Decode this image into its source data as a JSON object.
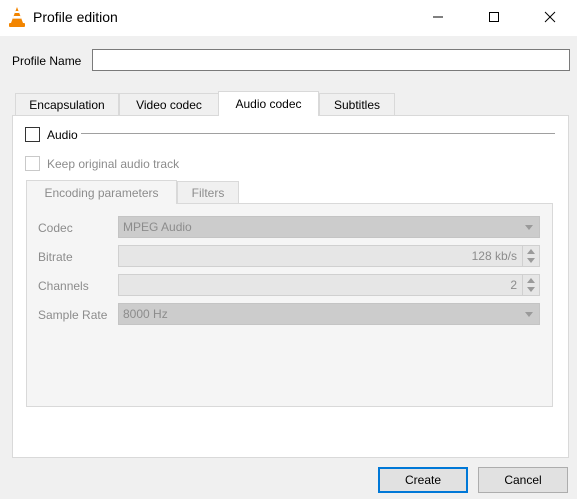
{
  "window": {
    "title": "Profile edition",
    "icon": "vlc-cone-icon",
    "controls": [
      "minimize-icon",
      "maximize-icon",
      "close-icon"
    ]
  },
  "profile": {
    "label": "Profile Name",
    "value": "",
    "placeholder": ""
  },
  "tabs": [
    {
      "label": "Encapsulation",
      "active": false
    },
    {
      "label": "Video codec",
      "active": false
    },
    {
      "label": "Audio codec",
      "active": true
    },
    {
      "label": "Subtitles",
      "active": false
    }
  ],
  "audio": {
    "enable_label": "Audio",
    "enable_checked": false,
    "keep_original_label": "Keep original audio track",
    "keep_original_checked": false,
    "subtabs": [
      {
        "label": "Encoding parameters",
        "active": true
      },
      {
        "label": "Filters",
        "active": false
      }
    ],
    "fields": {
      "codec": {
        "label": "Codec",
        "value": "MPEG Audio"
      },
      "bitrate": {
        "label": "Bitrate",
        "value": "128 kb/s"
      },
      "channels": {
        "label": "Channels",
        "value": "2"
      },
      "sample_rate": {
        "label": "Sample Rate",
        "value": "8000 Hz"
      }
    }
  },
  "buttons": {
    "create": "Create",
    "cancel": "Cancel"
  },
  "colors": {
    "accent": "#0078d7",
    "vlc_orange": "#f28500"
  }
}
